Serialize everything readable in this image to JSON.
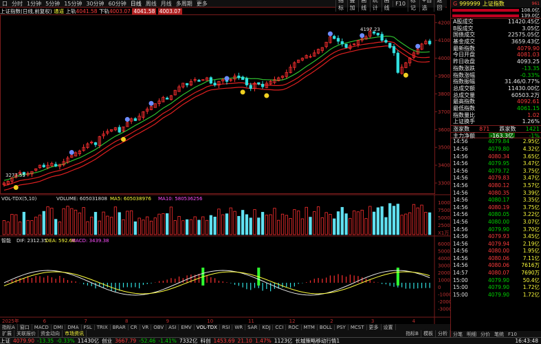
{
  "toolbar_left": {
    "icon_label": "口",
    "tabs": [
      "分时",
      "1分钟",
      "5分钟",
      "15分钟",
      "30分钟",
      "60分钟",
      "日线",
      "周线",
      "月线",
      "多周期",
      "更多"
    ]
  },
  "toolbar_right": {
    "tabs": [
      "指标",
      "叠加",
      "画线",
      "统计",
      "画线",
      "F10",
      "标记",
      "+自选",
      "返回"
    ]
  },
  "info": {
    "name": "上证指数(日线,前复权)",
    "ma_label": "通道",
    "up_label": "上轨",
    "up_val": "4041.58",
    "down_label": "下轨",
    "down_val": "4003.07",
    "ext": "4041.58",
    "ext2": "4003.07"
  },
  "price_axis": [
    "4200",
    "4100",
    "4000",
    "3900",
    "3800",
    "3700",
    "3600",
    "3500",
    "3400",
    "3300"
  ],
  "price_annot": {
    "high": "4197.23",
    "low": "3277.55"
  },
  "vol_info": {
    "name": "VOL-TDX(5,10)",
    "vol": "VOLUME: 605031808",
    "ma5": "MA5: 605038976",
    "ma10": "MA10: 580536256"
  },
  "vol_axis": [
    "100000",
    "75000",
    "50000",
    "25000",
    "X1万"
  ],
  "macd_info": {
    "name": "智能",
    "dif": "DIF: 2312.35",
    "dea": "DEA: 592.66",
    "macd": "MACD: 3439.38"
  },
  "macd_axis": [
    "6000",
    "5000",
    "4000",
    "3000",
    "2000",
    "1000",
    "0",
    "-1000",
    "-2000",
    "-3000"
  ],
  "date_axis": [
    "2025年",
    "6",
    "7",
    "8",
    "9",
    "10",
    "11",
    "12",
    "2",
    "3",
    "4"
  ],
  "right_panel": {
    "code": "999999",
    "name": "上证指数",
    "tag": "961",
    "ratio1": "108.0亿",
    "ratio2": "139.0亿",
    "rows": [
      {
        "label": "A股成交",
        "value": "11420.45亿",
        "color": "wht"
      },
      {
        "label": "B股成交",
        "value": "3.05亿",
        "color": "wht"
      },
      {
        "label": "国债成交",
        "value": "22575.05亿",
        "color": "wht"
      },
      {
        "label": "基金成交",
        "value": "3659.43亿",
        "color": "wht"
      },
      {
        "label": "最新指数",
        "value": "4079.90",
        "color": "red"
      },
      {
        "label": "今日开盘",
        "value": "4081.03",
        "color": "red"
      },
      {
        "label": "昨日收盘",
        "value": "4093.25",
        "color": "wht"
      },
      {
        "label": "指数涨跌",
        "value": "-13.35",
        "color": "grn"
      },
      {
        "label": "指数涨幅",
        "value": "-0.33%",
        "color": "grn"
      },
      {
        "label": "指数振幅",
        "value": "31.46/0.77%",
        "color": "wht"
      },
      {
        "label": "总成交额",
        "value": "11430.00亿",
        "color": "wht"
      },
      {
        "label": "总成交量",
        "value": "60503.2万",
        "color": "wht"
      },
      {
        "label": "最高指数",
        "value": "4092.61",
        "color": "red"
      },
      {
        "label": "最低指数",
        "value": "4061.15",
        "color": "grn"
      },
      {
        "label": "指数量比",
        "value": "1.02",
        "color": "red"
      },
      {
        "label": "上证换手",
        "value": "1.26%",
        "color": "wht"
      }
    ],
    "updown": {
      "up_label": "涨家数",
      "up_val": "871",
      "down_label": "跌家数",
      "down_val": "1421"
    },
    "flow": {
      "label": "主力净额",
      "val": "-163.3亿",
      "pct": "-1%"
    },
    "ticks": [
      {
        "t": "14:56",
        "p": "4079.84",
        "v": "2.95亿",
        "c": "grn"
      },
      {
        "t": "14:56",
        "p": "4079.80",
        "v": "4.32亿",
        "c": "grn"
      },
      {
        "t": "14:56",
        "p": "4080.34",
        "v": "3.65亿",
        "c": "red"
      },
      {
        "t": "14:56",
        "p": "4079.95",
        "v": "3.47亿",
        "c": "grn"
      },
      {
        "t": "14:56",
        "p": "4079.72",
        "v": "3.75亿",
        "c": "grn"
      },
      {
        "t": "14:56",
        "p": "4079.83",
        "v": "3.47亿",
        "c": "red"
      },
      {
        "t": "14:56",
        "p": "4080.12",
        "v": "3.57亿",
        "c": "red"
      },
      {
        "t": "14:56",
        "p": "4080.35",
        "v": "3.39亿",
        "c": "red"
      },
      {
        "t": "14:56",
        "p": "4080.17",
        "v": "3.35亿",
        "c": "grn"
      },
      {
        "t": "14:56",
        "p": "4080.19",
        "v": "3.75亿",
        "c": "red"
      },
      {
        "t": "14:56",
        "p": "4080.05",
        "v": "3.22亿",
        "c": "grn"
      },
      {
        "t": "14:56",
        "p": "4080.00",
        "v": "3.07亿",
        "c": "grn"
      },
      {
        "t": "14:56",
        "p": "4079.90",
        "v": "3.70亿",
        "c": "grn"
      },
      {
        "t": "14:56",
        "p": "4079.93",
        "v": "3.45亿",
        "c": "red"
      },
      {
        "t": "14:56",
        "p": "4079.94",
        "v": "2.19亿",
        "c": "red"
      },
      {
        "t": "14:56",
        "p": "4080.00",
        "v": "1.95亿",
        "c": "red"
      },
      {
        "t": "14:56",
        "p": "4080.06",
        "v": "7.11亿",
        "c": "red"
      },
      {
        "t": "14:56",
        "p": "4080.06",
        "v": "7616万",
        "c": "red"
      },
      {
        "t": "14:57",
        "p": "4080.07",
        "v": "7690万",
        "c": "red"
      },
      {
        "t": "15:00",
        "p": "4079.90",
        "v": "50.4亿",
        "c": "grn"
      },
      {
        "t": "15:00",
        "p": "4079.90",
        "v": "1.72亿",
        "c": "grn"
      },
      {
        "t": "15:00",
        "p": "4079.90",
        "v": "1.72亿",
        "c": "grn"
      }
    ],
    "bottom_tabs": [
      "分笔",
      "明细",
      "分价",
      "笔统",
      "F10"
    ]
  },
  "bottom_tabs1": [
    "指标A",
    "窗口",
    "MACD",
    "DMI",
    "DMA",
    "FSL",
    "TRIX",
    "BRAR",
    "CR",
    "VR",
    "OBV",
    "ASI",
    "EMV",
    "VOL-TDX",
    "RSI",
    "WR",
    "SAR",
    "KDJ",
    "CCI",
    "ROC",
    "MTM",
    "BOLL",
    "PSY",
    "MCST",
    "更多",
    "设置"
  ],
  "bottom_tabs2": [
    "扩展",
    "关联报价",
    "资金动向",
    "市场资讯"
  ],
  "bottom_tabs2_right": [
    "指标B",
    "模板",
    "分析"
  ],
  "status": [
    {
      "t": "上证",
      "c": "wht"
    },
    {
      "t": "4079.90",
      "c": "red"
    },
    {
      "t": "-13.35",
      "c": "grn"
    },
    {
      "t": "-0.33%",
      "c": "grn"
    },
    {
      "t": "11430亿",
      "c": "wht"
    },
    {
      "t": "创业",
      "c": "wht"
    },
    {
      "t": "3667.79",
      "c": "red"
    },
    {
      "t": "-52.46",
      "c": "grn"
    },
    {
      "t": "-1.41%",
      "c": "grn"
    },
    {
      "t": "7332亿",
      "c": "wht"
    },
    {
      "t": "科创",
      "c": "wht"
    },
    {
      "t": "1453.69",
      "c": "red"
    },
    {
      "t": "21.10",
      "c": "red"
    },
    {
      "t": "1.47%",
      "c": "red"
    },
    {
      "t": "1123亿",
      "c": "wht"
    },
    {
      "t": "长城策略移动行情1",
      "c": "wht"
    }
  ],
  "status_time": "16:43:48",
  "chart_data": {
    "type": "candlestick",
    "close": [
      3300,
      3310,
      3330,
      3345,
      3360,
      3350,
      3355,
      3365,
      3380,
      3400,
      3390,
      3400,
      3410,
      3395,
      3405,
      3420,
      3440,
      3455,
      3470,
      3480,
      3500,
      3520,
      3530,
      3515,
      3560,
      3575,
      3590,
      3600,
      3610,
      3585,
      3615,
      3640,
      3660,
      3650,
      3675,
      3700,
      3715,
      3730,
      3745,
      3760,
      3780,
      3770,
      3790,
      3820,
      3840,
      3860,
      3850,
      3870,
      3880,
      3870,
      3880,
      3890,
      3860,
      3850,
      3870,
      3880,
      3870,
      3880,
      3900,
      3890,
      3880,
      3850,
      3830,
      3860,
      3855,
      3840,
      3860,
      3870,
      3880,
      3890,
      3900,
      3920,
      3950,
      3975,
      3990,
      4000,
      4015,
      4010,
      4030,
      4050,
      4060,
      4090,
      4120,
      4110,
      4095,
      4080,
      4060,
      4070,
      4080,
      4100,
      4110,
      4120,
      4150,
      4140,
      4130,
      4100,
      4090,
      4060,
      4030,
      3920,
      3950,
      3975,
      4000,
      4030,
      4050,
      4080,
      4095,
      4080
    ]
  }
}
